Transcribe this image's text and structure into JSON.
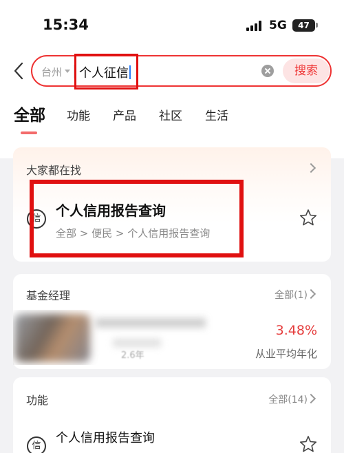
{
  "status_bar": {
    "time": "15:34",
    "network": "5G",
    "battery": "47"
  },
  "search": {
    "city": "台州",
    "query": "个人征信",
    "button_label": "搜索"
  },
  "tabs": [
    {
      "label": "全部",
      "active": true
    },
    {
      "label": "功能"
    },
    {
      "label": "产品"
    },
    {
      "label": "社区"
    },
    {
      "label": "生活"
    }
  ],
  "popular": {
    "title": "大家都在找",
    "result": {
      "icon_char": "信",
      "title": "个人信用报告查询",
      "path": "全部 > 便民 > 个人信用报告查询"
    }
  },
  "fund_manager": {
    "title": "基金经理",
    "all_label": "全部(1)",
    "blurred_years": "2.6年",
    "rate": "3.48%",
    "rate_label": "从业平均年化"
  },
  "functions": {
    "title": "功能",
    "all_label": "全部(14)",
    "first_item": {
      "icon_char": "信",
      "title": "个人信用报告查询"
    }
  },
  "colors": {
    "accent": "#e33333",
    "highlight_box": "#e01010",
    "rate": "#e53c3c"
  }
}
